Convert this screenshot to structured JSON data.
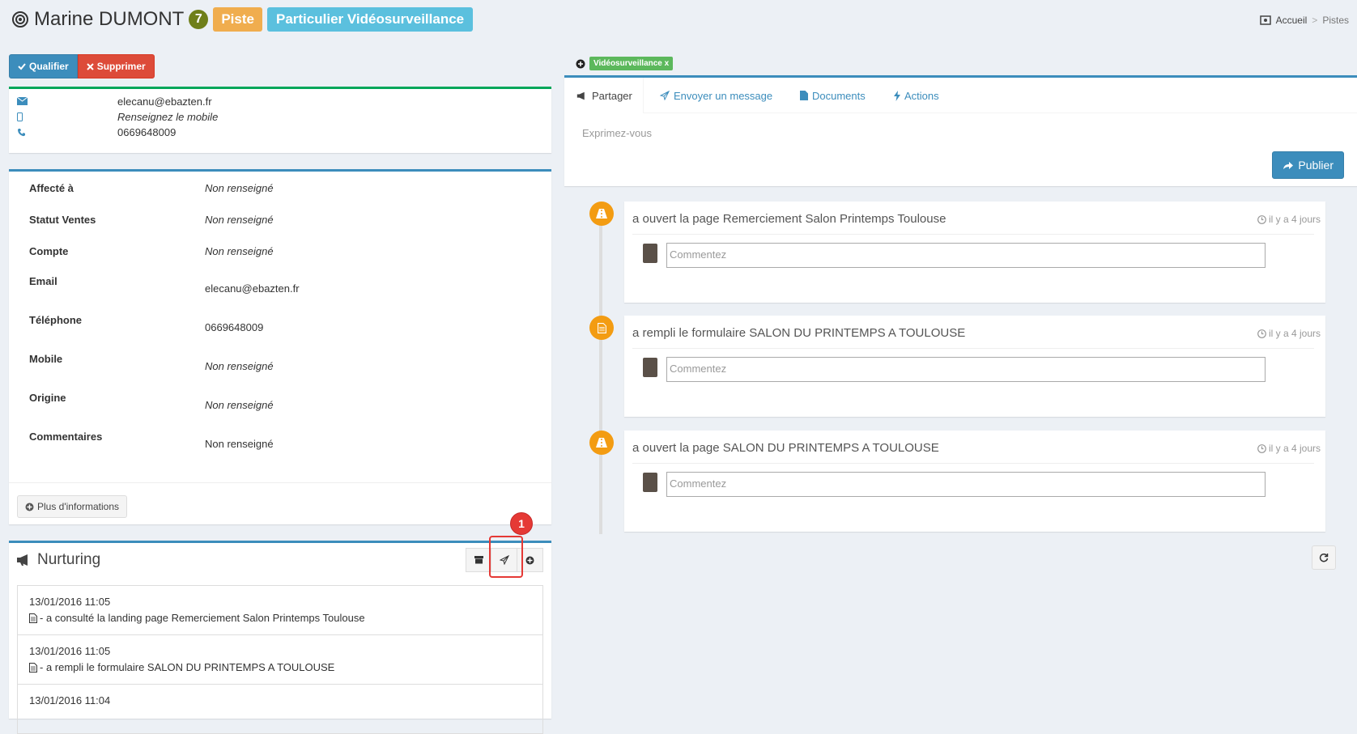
{
  "header": {
    "name": "Marine DUMONT",
    "score": "7",
    "label_piste": "Piste",
    "label_type": "Particulier Vidéosurveillance",
    "breadcrumb": {
      "home": "Accueil",
      "sep": ">",
      "current": "Pistes"
    }
  },
  "actions": {
    "qualifier": "Qualifier",
    "supprimer": "Supprimer"
  },
  "contact": {
    "email": "elecanu@ebazten.fr",
    "mobile": "Renseignez le mobile",
    "phone": "0669648009"
  },
  "info": {
    "rows": [
      {
        "label": "Affecté à",
        "value": "Non renseigné"
      },
      {
        "label": "Statut Ventes",
        "value": "Non renseigné"
      },
      {
        "label": "Compte",
        "value": "Non renseigné"
      },
      {
        "label": "Email",
        "value": "elecanu@ebazten.fr"
      },
      {
        "label": "Téléphone",
        "value": "0669648009"
      },
      {
        "label": "Mobile",
        "value": "Non renseigné"
      },
      {
        "label": "Origine",
        "value": "Non renseigné"
      },
      {
        "label": "Commentaires",
        "value": "Non renseigné"
      }
    ],
    "more_button": "Plus d'informations"
  },
  "nurturing": {
    "title": "Nurturing",
    "highlight_badge": "1",
    "items": [
      {
        "date": "13/01/2016 11:05",
        "desc": "- a consulté la landing page Remerciement Salon Printemps Toulouse"
      },
      {
        "date": "13/01/2016 11:05",
        "desc": "- a rempli le formulaire SALON DU PRINTEMPS A TOULOUSE"
      },
      {
        "date": "13/01/2016 11:04",
        "desc": ""
      }
    ]
  },
  "tags": {
    "video": "Vidéosurveillance x"
  },
  "share": {
    "tabs": [
      "Partager",
      "Envoyer un message",
      "Documents",
      "Actions"
    ],
    "placeholder": "Exprimez-vous",
    "publish": "Publier"
  },
  "timeline": [
    {
      "text": "a ouvert la page Remerciement Salon Printemps Toulouse",
      "time": "il y a 4 jours",
      "placeholder": "Commentez",
      "icon": "road-icon"
    },
    {
      "text": "a rempli le formulaire SALON DU PRINTEMPS A TOULOUSE",
      "time": "il y a 4 jours",
      "placeholder": "Commentez",
      "icon": "document-icon"
    },
    {
      "text": "a ouvert la page SALON DU PRINTEMPS A TOULOUSE",
      "time": "il y a 4 jours",
      "placeholder": "Commentez",
      "icon": "road-icon"
    }
  ],
  "colors": {
    "primary": "#3c8dbc",
    "danger": "#dd4b39",
    "warning": "#f0ad4e",
    "info": "#5bc0de",
    "success": "#00a65a",
    "timeline": "#f39c12"
  }
}
